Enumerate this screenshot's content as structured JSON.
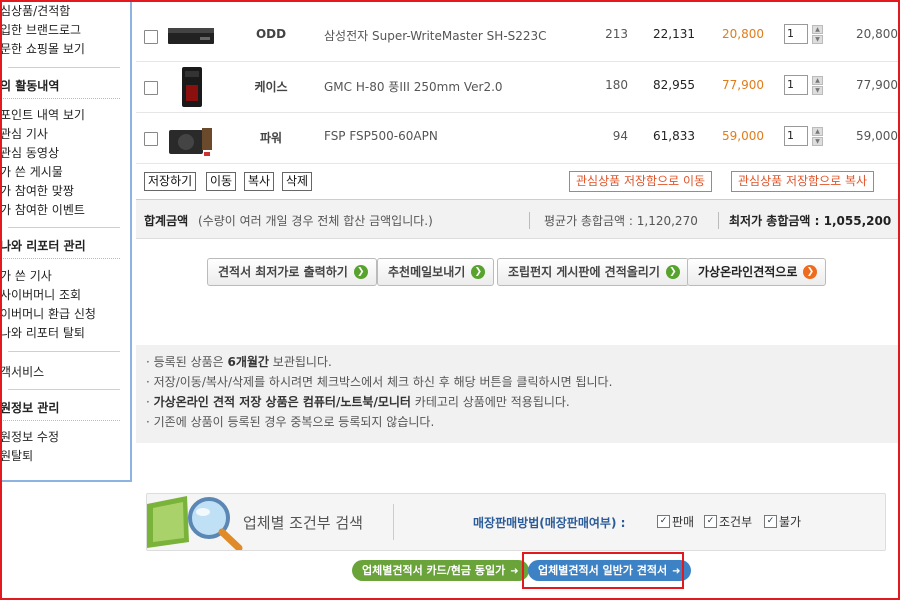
{
  "sidebar": {
    "group1_items": [
      "심상품/견적함",
      "입한 브랜드로그",
      "문한 쇼핑몰 보기"
    ],
    "section_activity": "의 활동내역",
    "activity_items": [
      "포인트 내역 보기",
      "관심 기사",
      "관심 동영상",
      "가 쓴 게시물",
      "가 참여한 맞짱",
      "가 참여한 이벤트"
    ],
    "section_reporter": "나와 리포터 관리",
    "reporter_items": [
      "가 쓴 기사",
      "사이버머니 조회",
      "이버머니 환급 신청",
      "나와 리포터 탈퇴"
    ],
    "customer_service": "객서비스",
    "section_member": "원정보 관리",
    "member_items": [
      "원정보 수정",
      "원탈퇴"
    ]
  },
  "products": [
    {
      "category": "ODD",
      "name": "삼성전자 Super-WriteMaster SH-S223C",
      "count": "213",
      "avg_price": "22,131",
      "low_price": "20,800",
      "qty": "1",
      "subtotal": "20,800"
    },
    {
      "category": "케이스",
      "name": "GMC H-80 풍III 250mm Ver2.0",
      "count": "180",
      "avg_price": "82,955",
      "low_price": "77,900",
      "qty": "1",
      "subtotal": "77,900"
    },
    {
      "category": "파워",
      "name": "FSP FSP500-60APN",
      "count": "94",
      "avg_price": "61,833",
      "low_price": "59,000",
      "qty": "1",
      "subtotal": "59,000"
    }
  ],
  "actions": {
    "save": "저장하기",
    "move": "이동",
    "copy": "복사",
    "delete": "삭제",
    "move_to_wishlist": "관심상품 저장함으로 이동",
    "copy_to_wishlist": "관심상품 저장함으로 복사"
  },
  "total": {
    "label": "합계금액",
    "note": "(수량이 여러 개일 경우 전체 합산 금액입니다.)",
    "avg_total": "평균가 총합금액 : 1,120,270",
    "low_total": "최저가 총합금액 : 1,055,200"
  },
  "buttons": {
    "print_lowest": "견적서 최저가로 출력하기",
    "send_mail": "추천메일보내기",
    "post_board": "조립펀지 게시판에 견적올리기",
    "goto_online": "가상온라인견적으로"
  },
  "notices": [
    {
      "pre": "· 등록된 상품은 ",
      "bold": "6개월간",
      "post": " 보관됩니다."
    },
    {
      "pre": "· 저장/이동/복사/삭제를 하시려면 체크박스에서 체크 하신 후 해당 버튼을 클릭하시면 됩니다.",
      "bold": "",
      "post": ""
    },
    {
      "pre": "· ",
      "bold": "가상온라인 견적 저장 상품은 컴퓨터/노트북/모니터",
      "post": " 카테고리 상품에만 적용됩니다."
    },
    {
      "pre": "· 기존에 상품이 등록된 경우 중복으로 등록되지 않습니다.",
      "bold": "",
      "post": ""
    }
  ],
  "search": {
    "title": "업체별 조건부 검색",
    "method_label": "매장판매방법(매장판매여부) :",
    "options": [
      "판매",
      "조건부",
      "불가"
    ]
  },
  "bottom_buttons": {
    "card_cash": "업체별견적서 카드/현금 동일가",
    "general": "업체별견적서 일반가 견적서"
  },
  "colors": {
    "accent_orange": "#e07c1b",
    "sidebar_border": "#8db3e2",
    "highlight_red": "#e2191e"
  }
}
